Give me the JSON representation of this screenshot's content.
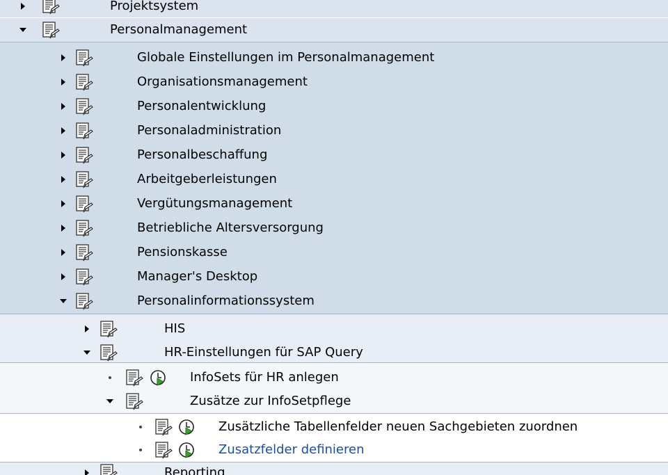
{
  "tree": {
    "projektsystem": "Projektsystem",
    "personalmanagement": "Personalmanagement",
    "pm_children": [
      "Globale Einstellungen im Personalmanagement",
      "Organisationsmanagement",
      "Personalentwicklung",
      "Personaladministration",
      "Personalbeschaffung",
      "Arbeitgeberleistungen",
      "Vergütungsmanagement",
      "Betriebliche Altersversorgung",
      "Pensionskasse",
      "Manager's Desktop"
    ],
    "personalinformationssystem": "Personalinformationssystem",
    "his": "HIS",
    "hr_query": "HR-Einstellungen für SAP Query",
    "infosets": "InfoSets für HR anlegen",
    "zusaetze": "Zusätze zur InfoSetpflege",
    "tabellenfelder": "Zusätzliche Tabellenfelder neuen Sachgebieten zuordnen",
    "zusatzfelder": "Zusatzfelder definieren",
    "reporting": "Reporting"
  },
  "icons": {
    "expander_collapsed": "triangle-right-icon",
    "expander_expanded": "triangle-down-icon",
    "leaf": "bullet-icon",
    "node": "document-icon",
    "activity": "execute-clock-icon"
  },
  "colors": {
    "level0_bg": "#dbe4ee",
    "level1_bg": "#d0dde9",
    "level2_bg": "#e8eef5",
    "level3_bg": "#f4f7fa",
    "link": "#1a4f9c"
  }
}
